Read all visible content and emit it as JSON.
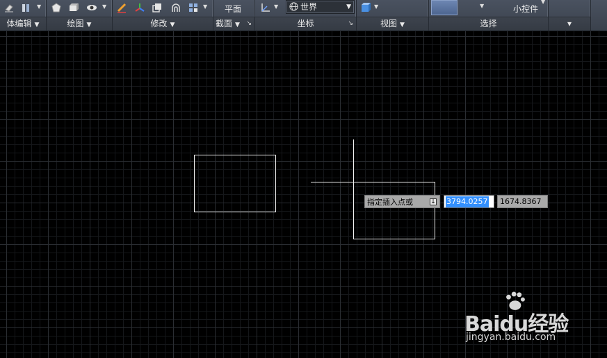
{
  "ribbon": {
    "panels": [
      {
        "title": "体编辑",
        "has_dropdown": true
      },
      {
        "title": "绘图",
        "has_dropdown": true
      },
      {
        "title": "修改",
        "has_dropdown": true
      },
      {
        "title": "截面",
        "has_dropdown": true
      },
      {
        "title": "坐标",
        "has_dropdown": false
      },
      {
        "title": "视图",
        "has_dropdown": true
      },
      {
        "title": "选择",
        "has_dropdown": false
      }
    ],
    "section_plane_label": "平面",
    "ucs_value": "世界",
    "gizmo_label": "小控件",
    "more_arrow": "▾"
  },
  "icons": [
    "eraser-icon",
    "extrude-icon",
    "polygon-icon",
    "box-icon",
    "view-eye-icon",
    "pencil-icon",
    "gizmo-icon",
    "copy-icon",
    "offset-icon",
    "array-icon",
    "ucs-icon",
    "view-cube-icon"
  ],
  "colors": {
    "ribbon_bg": "#3f4651",
    "canvas_bg": "#000000",
    "grid_major": "#2a2d32",
    "selection_highlight": "#3390ff",
    "tooltip_bg": "#a9a9a9"
  },
  "dynamic_input": {
    "prompt": "指定插入点或",
    "x_value": "3794.0257",
    "y_value": "1674.8367"
  },
  "watermark": {
    "brand": "Baidu经验",
    "url": "jingyan.baidu.com"
  }
}
